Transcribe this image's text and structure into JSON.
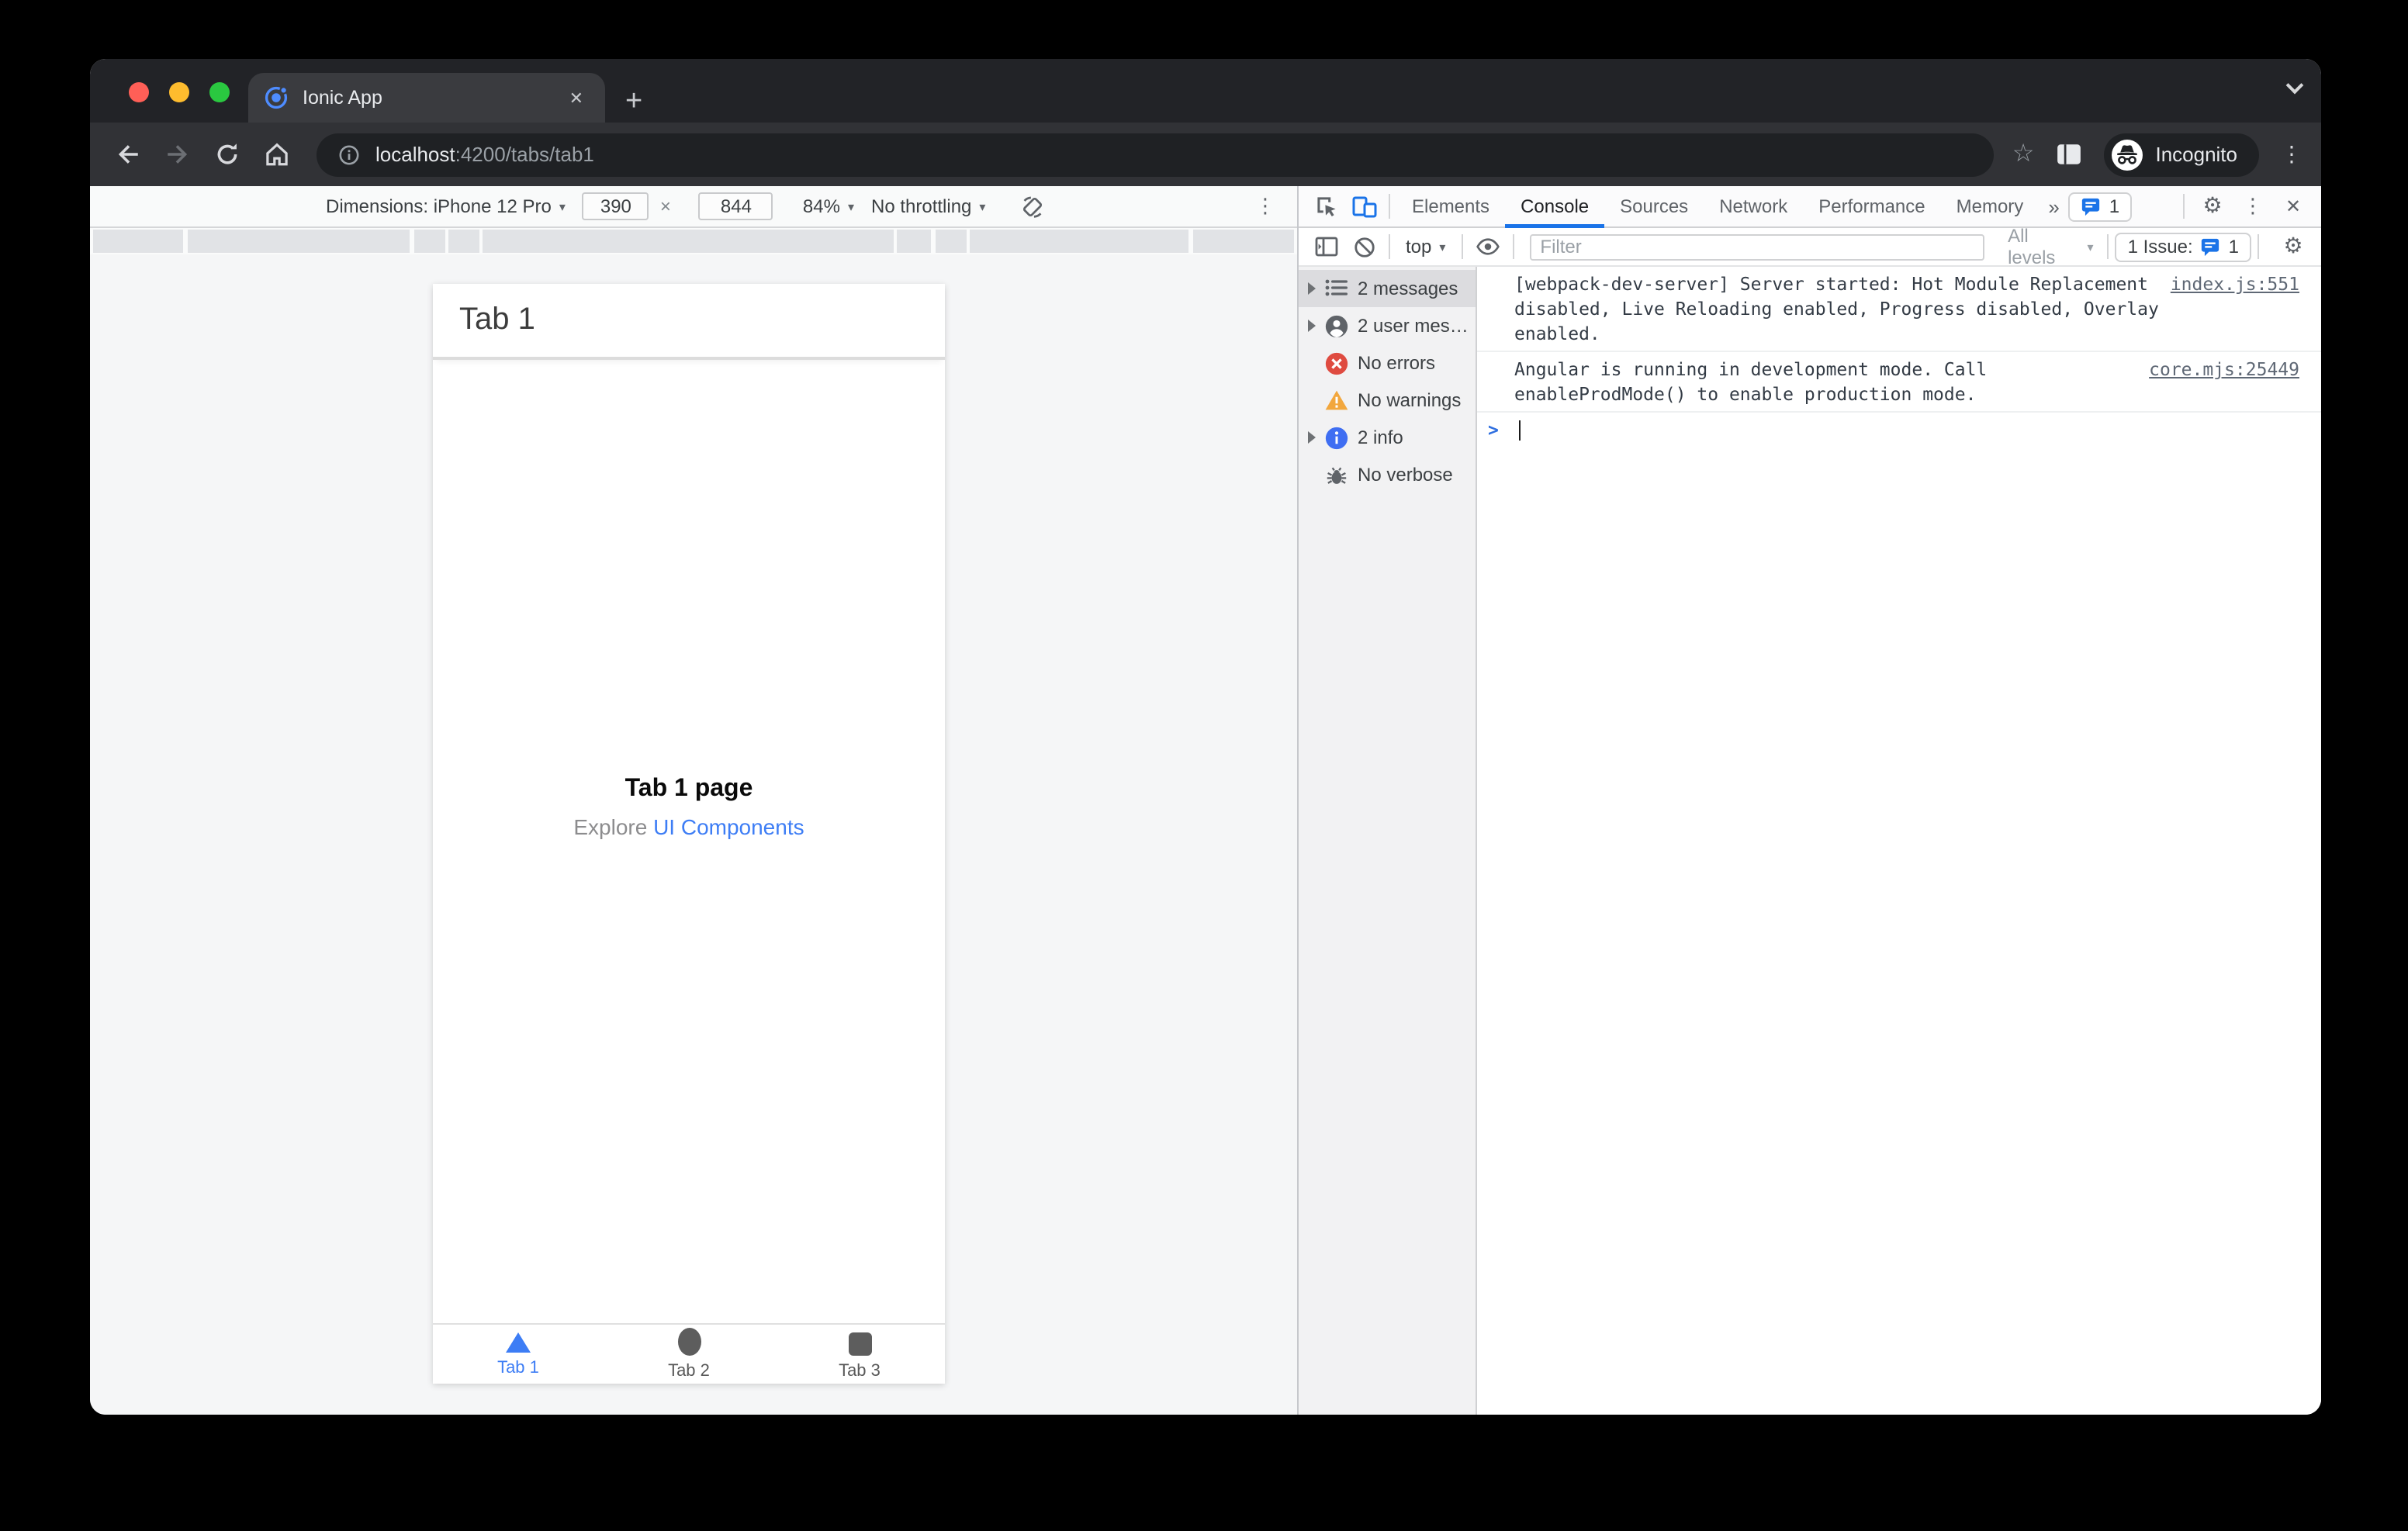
{
  "browser": {
    "tab_title": "Ionic App",
    "url_host": "localhost",
    "url_rest": ":4200/tabs/tab1",
    "incognito_label": "Incognito"
  },
  "device_toolbar": {
    "dimensions_label": "Dimensions: iPhone 12 Pro",
    "width_value": "390",
    "size_separator": "×",
    "height_value": "844",
    "zoom_value": "84%",
    "throttling_value": "No throttling"
  },
  "app": {
    "header_title": "Tab 1",
    "page_title": "Tab 1 page",
    "explore_text": "Explore ",
    "explore_link_text": "UI Components",
    "tabs": [
      {
        "label": "Tab 1"
      },
      {
        "label": "Tab 2"
      },
      {
        "label": "Tab 3"
      }
    ]
  },
  "devtools": {
    "tabs": [
      "Elements",
      "Console",
      "Sources",
      "Network",
      "Performance",
      "Memory"
    ],
    "active_tab": "Console",
    "tabbar_issues_count": "1",
    "console": {
      "context": "top",
      "filter_placeholder": "Filter",
      "levels_label": "All levels",
      "issues_button_text": "1 Issue:",
      "issues_button_count": "1",
      "prompt_glyph": ">",
      "sidebar": [
        {
          "icon": "list-icon",
          "label": "2 messages"
        },
        {
          "icon": "user-icon",
          "label": "2 user mes…"
        },
        {
          "icon": "error-icon",
          "label": "No errors"
        },
        {
          "icon": "warning-icon",
          "label": "No warnings"
        },
        {
          "icon": "info-icon",
          "label": "2 info"
        },
        {
          "icon": "bug-icon",
          "label": "No verbose"
        }
      ],
      "messages": [
        {
          "text": "[webpack-dev-server] Server started: Hot Module Replacement disabled, Live Reloading enabled, Progress disabled, Overlay enabled.",
          "source": "index.js:551"
        },
        {
          "text": "Angular is running in development mode. Call enableProdMode() to enable production mode.",
          "source": "core.mjs:25449"
        }
      ]
    }
  },
  "glyphs": {
    "dropdown": "▾",
    "more_tabs": "»",
    "kebab": "⋮",
    "gear": "⚙",
    "close": "✕",
    "close_tab": "✕",
    "new_tab": "+",
    "star": "☆"
  },
  "colors": {
    "accent_blue": "#1a73e8",
    "ionic_blue": "#3d7df5",
    "error_red": "#df4b40",
    "warning_yellow": "#f2a73d",
    "info_blue": "#3f6ef2"
  }
}
